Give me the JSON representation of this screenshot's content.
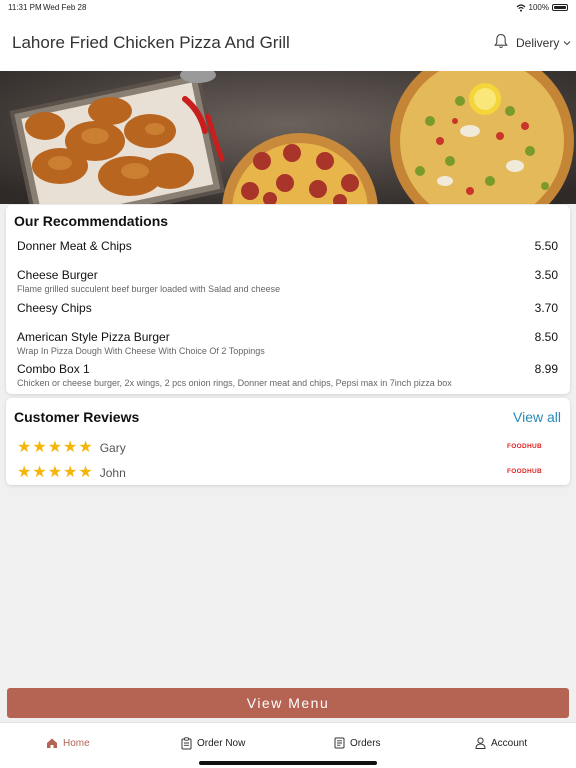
{
  "status_bar": {
    "time": "11:31 PM",
    "date": "Wed Feb 28",
    "battery": "100%"
  },
  "header": {
    "title": "Lahore Fried Chicken Pizza And Grill",
    "delivery_label": "Delivery",
    "bell_icon": "bell-icon",
    "chevron_icon": "chevron-down-icon"
  },
  "recommendations": {
    "title": "Our Recommendations",
    "items": [
      {
        "name": "Donner Meat & Chips",
        "description": "",
        "price": "5.50"
      },
      {
        "name": "Cheese Burger",
        "description": "Flame grilled succulent beef burger loaded with Salad and cheese",
        "price": "3.50"
      },
      {
        "name": "Cheesy Chips",
        "description": "",
        "price": "3.70"
      },
      {
        "name": "American Style Pizza Burger",
        "description": "Wrap In Pizza Dough With Cheese With Choice Of 2 Toppings",
        "price": "8.50"
      },
      {
        "name": "Combo Box 1",
        "description": "Chicken or cheese burger, 2x wings, 2 pcs onion rings, Donner meat and chips, Pepsi max in 7inch pizza box",
        "price": "8.99"
      }
    ]
  },
  "reviews": {
    "title": "Customer Reviews",
    "view_all": "View all",
    "items": [
      {
        "name": "Gary",
        "rating": 5,
        "source": "FOODHUB"
      },
      {
        "name": "John",
        "rating": 5,
        "source": "FOODHUB"
      }
    ]
  },
  "view_menu_label": "View Menu",
  "tabs": [
    {
      "label": "Home",
      "icon": "home-icon",
      "active": true
    },
    {
      "label": "Order Now",
      "icon": "clipboard-icon",
      "active": false
    },
    {
      "label": "Orders",
      "icon": "receipt-icon",
      "active": false
    },
    {
      "label": "Account",
      "icon": "person-icon",
      "active": false
    }
  ],
  "colors": {
    "accent": "#b56353",
    "link": "#2a8ab8",
    "star": "#f5b50a",
    "foodhub": "#dd2222"
  }
}
